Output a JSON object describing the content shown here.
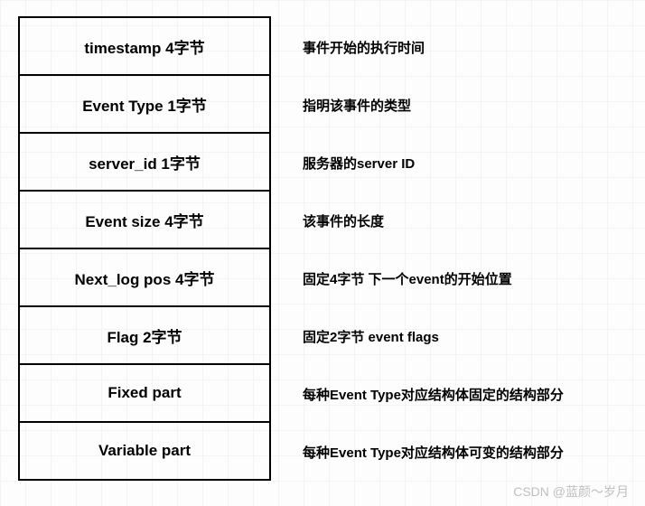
{
  "rows": [
    {
      "field": "timestamp 4字节",
      "desc": "事件开始的执行时间"
    },
    {
      "field": "Event Type 1字节",
      "desc": "指明该事件的类型"
    },
    {
      "field": "server_id 1字节",
      "desc": "服务器的server ID"
    },
    {
      "field": "Event size 4字节",
      "desc": "该事件的长度"
    },
    {
      "field": "Next_log pos 4字节",
      "desc": "固定4字节 下一个event的开始位置"
    },
    {
      "field": "Flag 2字节",
      "desc": "固定2字节 event flags"
    },
    {
      "field": "Fixed part",
      "desc": "每种Event Type对应结构体固定的结构部分"
    },
    {
      "field": "Variable part",
      "desc": "每种Event Type对应结构体可变的结构部分"
    }
  ],
  "watermark": "CSDN @蓝颜～岁月"
}
